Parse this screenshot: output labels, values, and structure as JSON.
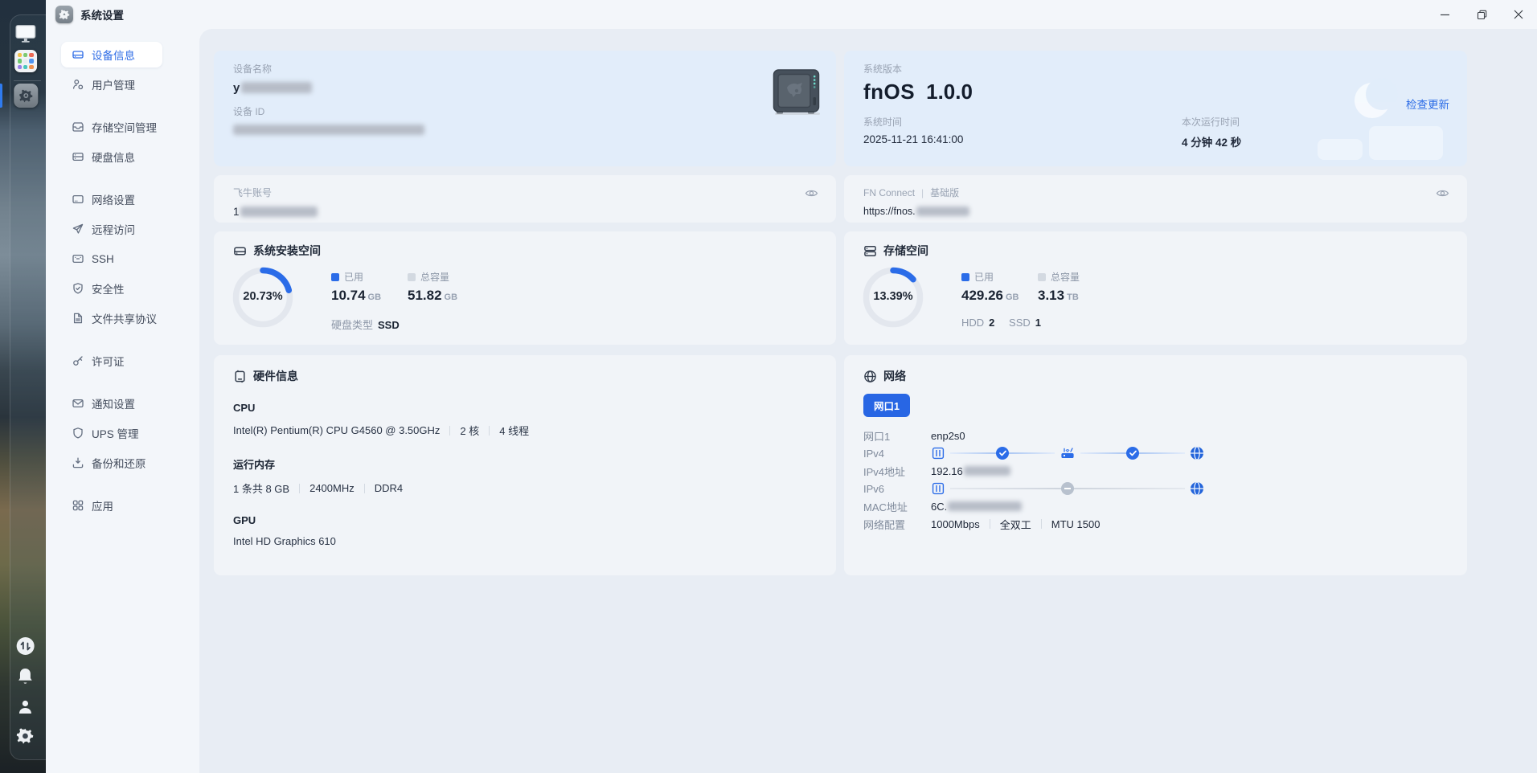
{
  "window": {
    "title": "系统设置"
  },
  "sidebar": {
    "items": [
      {
        "label": "设备信息"
      },
      {
        "label": "用户管理"
      },
      {
        "label": "存储空间管理"
      },
      {
        "label": "硬盘信息"
      },
      {
        "label": "网络设置"
      },
      {
        "label": "远程访问"
      },
      {
        "label": "SSH"
      },
      {
        "label": "安全性"
      },
      {
        "label": "文件共享协议"
      },
      {
        "label": "许可证"
      },
      {
        "label": "通知设置"
      },
      {
        "label": "UPS 管理"
      },
      {
        "label": "备份和还原"
      },
      {
        "label": "应用"
      }
    ]
  },
  "cards": {
    "device": {
      "name_label": "设备名称",
      "name_prefix": "y",
      "id_label": "设备 ID"
    },
    "version": {
      "label": "系统版本",
      "os_name": "fnOS",
      "os_version": "1.0.0",
      "check_update": "检查更新",
      "time_label": "系统时间",
      "time_value": "2025-11-21 16:41:00",
      "uptime_label": "本次运行时间",
      "uptime_value": "4 分钟 42 秒"
    },
    "account": {
      "label": "飞牛账号",
      "value_prefix": "1"
    },
    "connect": {
      "label": "FN Connect",
      "tier": "基础版",
      "url_prefix": "https://fnos."
    },
    "install": {
      "title": "系统安装空间",
      "percent_text": "20.73%",
      "percent_value": 20.73,
      "used_label": "已用",
      "used_value": "10.74",
      "used_unit": "GB",
      "total_label": "总容量",
      "total_value": "51.82",
      "total_unit": "GB",
      "disk_type_label": "硬盘类型",
      "disk_type_value": "SSD"
    },
    "storage": {
      "title": "存储空间",
      "percent_text": "13.39%",
      "percent_value": 13.39,
      "used_label": "已用",
      "used_value": "429.26",
      "used_unit": "GB",
      "total_label": "总容量",
      "total_value": "3.13",
      "total_unit": "TB",
      "hdd_label": "HDD",
      "hdd_count": "2",
      "ssd_label": "SSD",
      "ssd_count": "1"
    },
    "hardware": {
      "title": "硬件信息",
      "cpu_label": "CPU",
      "cpu_model": "Intel(R) Pentium(R) CPU G4560 @ 3.50GHz",
      "cpu_cores": "2 核",
      "cpu_threads": "4 线程",
      "ram_label": "运行内存",
      "ram_size": "1 条共 8 GB",
      "ram_speed": "2400MHz",
      "ram_type": "DDR4",
      "gpu_label": "GPU",
      "gpu_model": "Intel HD Graphics 610"
    },
    "network": {
      "title": "网络",
      "port_button": "网口1",
      "port_label": "网口1",
      "port_value": "enp2s0",
      "ipv4_label": "IPv4",
      "ipv4_addr_label": "IPv4地址",
      "ipv4_addr_prefix": "192.16",
      "ipv6_label": "IPv6",
      "mac_label": "MAC地址",
      "mac_prefix": "6C.",
      "config_label": "网络配置",
      "config_speed": "1000Mbps",
      "config_duplex": "全双工",
      "config_mtu": "MTU 1500"
    }
  },
  "colors": {
    "accent": "#2b6ce8",
    "card_blue": "#e2edfa",
    "card_gray": "#f1f4f8"
  }
}
